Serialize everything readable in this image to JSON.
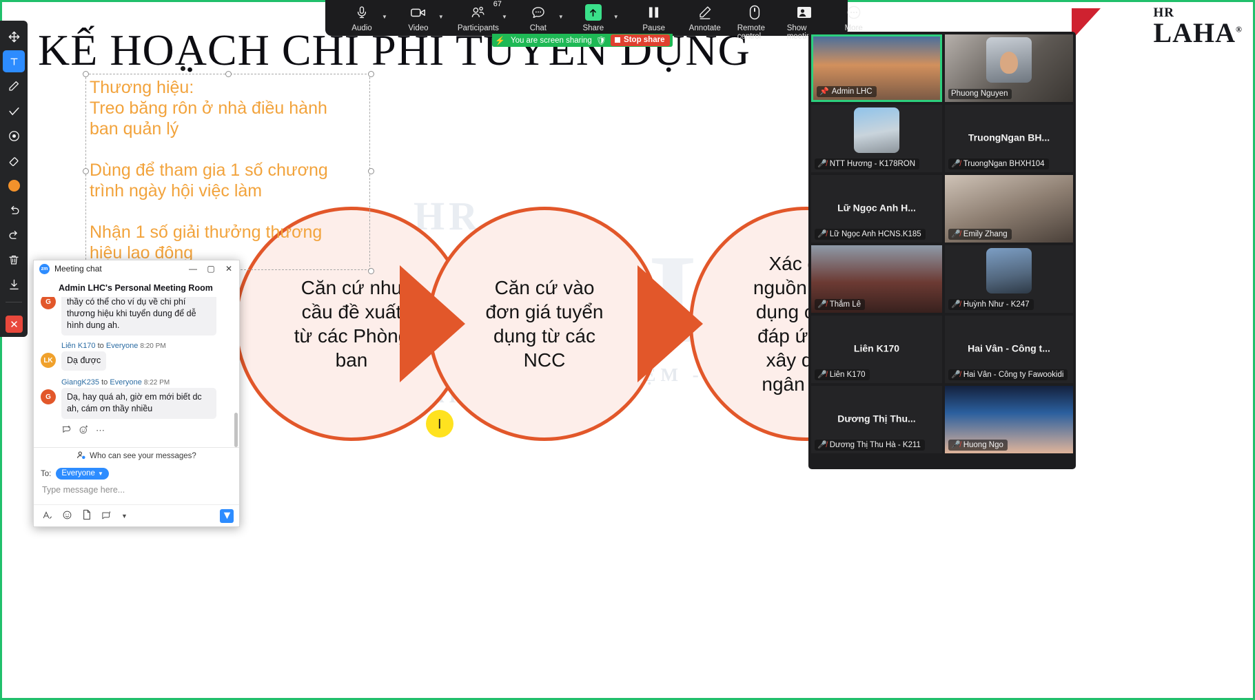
{
  "slide": {
    "title": "KẾ HOẠCH CHI PHÍ TUYỂN DỤNG",
    "textbox": "Thương hiệu:\nTreo băng rôn ở nhà điều hành\nban quản lý\n\nDùng để tham gia 1 số chương\ntrình ngày hội việc làm\n\nNhận 1 số giải thưởng thương\nhiệu lao đông",
    "watermark": {
      "top": "HR",
      "main": "LAHA",
      "sub": "TRAO KINH NGHIỆM - TẶNG TƯƠNG LAI"
    },
    "diagram": [
      "Căn cứ nhu\ncầu đề xuất\ntừ các Phòng\nban",
      "Căn cứ vào\nđơn giá tuyển\ndụng từ các\nNCC",
      "Xác định\nnguồn tuyển\ndụng có thể\nđáp ứng và\nxây dựng\nngân sách"
    ],
    "logo": {
      "hr": "HR",
      "name": "LAHA",
      "reg": "®"
    }
  },
  "top_toolbar": {
    "items": [
      {
        "label": "Audio",
        "icon": "microphone-icon",
        "caret": true,
        "badge": ""
      },
      {
        "label": "Video",
        "icon": "camera-icon",
        "caret": true,
        "badge": ""
      },
      {
        "label": "Participants",
        "icon": "participants-icon",
        "caret": true,
        "badge": "67"
      },
      {
        "label": "Chat",
        "icon": "chat-bubble-icon",
        "caret": true,
        "badge": ""
      },
      {
        "label": "Share",
        "icon": "share-screen-icon",
        "caret": true,
        "badge": ""
      },
      {
        "label": "Pause",
        "icon": "pause-icon",
        "caret": false,
        "badge": ""
      },
      {
        "label": "Annotate",
        "icon": "pencil-icon",
        "caret": false,
        "badge": ""
      },
      {
        "label": "Remote control",
        "icon": "mouse-icon",
        "caret": false,
        "badge": ""
      },
      {
        "label": "Show meeting",
        "icon": "show-meeting-icon",
        "caret": false,
        "badge": ""
      },
      {
        "label": "More",
        "icon": "more-dots-icon",
        "caret": false,
        "badge": ""
      }
    ]
  },
  "share_status": {
    "text": "You are screen sharing",
    "stop_label": "Stop share"
  },
  "left_toolbar": {
    "items": [
      {
        "name": "select-move-tool",
        "icon": "move-arrows-icon",
        "active": false
      },
      {
        "name": "text-tool",
        "icon": "text-t-icon",
        "active": true
      },
      {
        "name": "draw-tool",
        "icon": "pen-icon",
        "active": false
      },
      {
        "name": "stamp-tool",
        "icon": "check-mark-icon",
        "active": false
      },
      {
        "name": "spotlight-tool",
        "icon": "spotlight-icon",
        "active": false
      },
      {
        "name": "eraser-tool",
        "icon": "eraser-icon",
        "active": false
      },
      {
        "name": "color-picker",
        "icon": "color-dot-icon",
        "active": false,
        "color": "#f2922b"
      },
      {
        "name": "undo-button",
        "icon": "undo-arrow-icon",
        "active": false
      },
      {
        "name": "redo-button",
        "icon": "redo-arrow-icon",
        "active": false
      },
      {
        "name": "clear-button",
        "icon": "trash-icon",
        "active": false
      },
      {
        "name": "save-button",
        "icon": "download-icon",
        "active": false
      },
      {
        "name": "more-button",
        "icon": "more-dots-icon",
        "active": false
      }
    ],
    "close_label": "✕"
  },
  "chat": {
    "window_title": "Meeting chat",
    "logo_text": "zm",
    "room_title": "Admin LHC's Personal Meeting Room",
    "minimize": "—",
    "maximize": "▢",
    "close": "✕",
    "messages": [
      {
        "sender": "",
        "to": "",
        "target": "",
        "time": "",
        "avatar_letter": "G",
        "avatar_color": "#e2572a",
        "text": "thầy có thể cho ví dụ về chi phí thương hiệu  khi tuyển dung để dễ hình dung ah.",
        "partial": true
      },
      {
        "sender": "Liên K170",
        "to": "to",
        "target": "Everyone",
        "time": "8:20 PM",
        "avatar_letter": "LK",
        "avatar_color": "#f0a12c",
        "text": "Dạ được",
        "partial": false
      },
      {
        "sender": "GiangK235",
        "to": "to",
        "target": "Everyone",
        "time": "8:22 PM",
        "avatar_letter": "G",
        "avatar_color": "#e2572a",
        "text": "Dạ, hay quá ah, giờ em mới biết dc ah, cám ơn thầy nhiều",
        "partial": false
      }
    ],
    "msg_actions": [
      "reply-icon",
      "emoji-icon",
      "more-icon"
    ],
    "who_can_see": "Who can see your messages?",
    "to_label": "To:",
    "to_value": "Everyone",
    "input_placeholder": "Type message here...",
    "input_value": "",
    "bottom_icons": [
      "format-text-icon",
      "emoji-icon",
      "file-icon",
      "screenshot-icon",
      "chevron-down-icon"
    ],
    "send_icon": "send-icon"
  },
  "participants": {
    "tiles": [
      {
        "name": "Admin LHC",
        "display": "overlay",
        "muted": false,
        "pinned": true,
        "active": true,
        "kind": "video",
        "video": "vid-a"
      },
      {
        "name": "Phuong Nguyen",
        "display": "overlay",
        "muted": false,
        "pinned": false,
        "active": false,
        "kind": "video",
        "video": "vid-b"
      },
      {
        "name": "NTT Hương - K178RON",
        "display": "overlay",
        "muted": true,
        "pinned": false,
        "active": false,
        "kind": "avatar",
        "avatar": "ava-car"
      },
      {
        "name": "TruongNgan BHXH104",
        "center_name": "TruongNgan BH...",
        "display": "center",
        "muted": true,
        "pinned": false,
        "active": false,
        "kind": "name"
      },
      {
        "name": "Lữ Ngọc Anh HCNS.K185",
        "center_name": "Lữ Ngọc Anh H...",
        "display": "center",
        "muted": true,
        "pinned": false,
        "active": false,
        "kind": "name"
      },
      {
        "name": "Emily Zhang",
        "display": "overlay",
        "muted": true,
        "pinned": false,
        "active": false,
        "kind": "video",
        "video": "vid-c"
      },
      {
        "name": "Thắm Lê",
        "display": "overlay",
        "muted": true,
        "pinned": false,
        "active": false,
        "kind": "video",
        "video": "vid-d"
      },
      {
        "name": "Huỳnh Như - K247",
        "display": "overlay",
        "muted": true,
        "pinned": false,
        "active": false,
        "kind": "avatar",
        "avatar": "ava-man"
      },
      {
        "name": "Liên K170",
        "center_name": "Liên K170",
        "display": "center",
        "muted": true,
        "pinned": false,
        "active": false,
        "kind": "name"
      },
      {
        "name": "Hai Vân - Công ty Fawookidi",
        "center_name": "Hai Vân - Công t...",
        "display": "center",
        "muted": true,
        "pinned": false,
        "active": false,
        "kind": "name"
      },
      {
        "name": "Dương Thị Thu Hà - K211",
        "center_name": "Dương Thị Thu...",
        "display": "center",
        "muted": true,
        "pinned": false,
        "active": false,
        "kind": "name"
      },
      {
        "name": "Huong Ngo",
        "display": "overlay",
        "muted": true,
        "pinned": false,
        "active": false,
        "kind": "video",
        "video": "vid-e"
      }
    ]
  }
}
